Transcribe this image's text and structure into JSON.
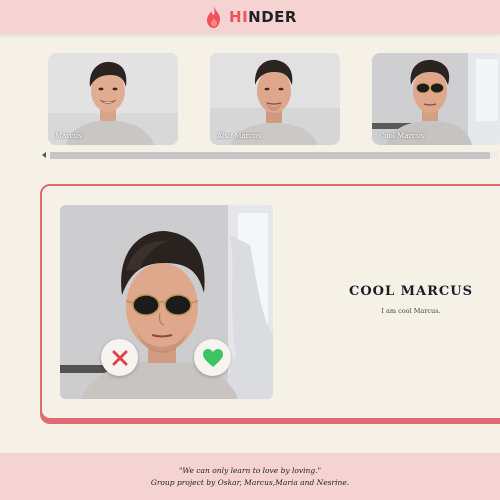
{
  "header": {
    "logo_icon": "flame-icon",
    "brand_prefix": "HI",
    "brand_suffix": "NDER",
    "brand_accent_color": "#f0525a"
  },
  "carousel": {
    "items": [
      {
        "caption": "Marcus"
      },
      {
        "caption": "Also Marcus"
      },
      {
        "caption": "Cool Marcus"
      }
    ],
    "scrollbar": {
      "left_arrow_icon": "chevron-left-icon"
    }
  },
  "profile": {
    "name": "COOL MARCUS",
    "bio": "I am cool Marcus.",
    "reject_icon": "x-icon",
    "like_icon": "heart-icon",
    "reject_color": "#e0424c",
    "like_color": "#3cc464"
  },
  "footer": {
    "quote": "\"We can only learn to love by loving.\"",
    "credits": "Group project by Oskar, Marcus,Maria and Nesrine."
  },
  "colors": {
    "header_bg": "#f5d3d3",
    "page_bg": "#f6f1e6",
    "card_border": "#e06a74"
  }
}
